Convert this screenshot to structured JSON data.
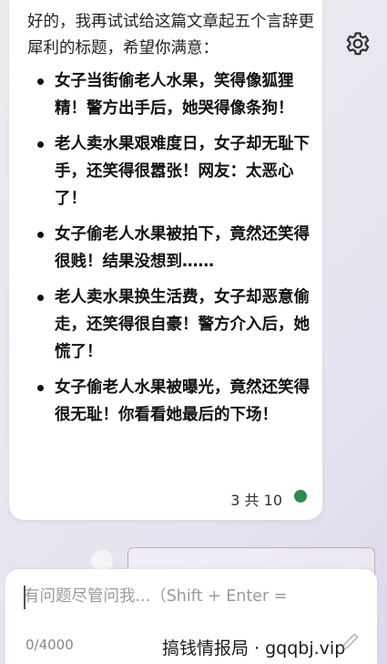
{
  "message": {
    "intro": "好的，我再试试给这篇文章起五个言辞更犀利的标题，希望你满意：",
    "titles": [
      "女子当街偷老人水果，笑得像狐狸精！警方出手后，她哭得像条狗！",
      "老人卖水果艰难度日，女子却无耻下手，还笑得很嚣张！网友：太恶心了！",
      "女子偷老人水果被拍下，竟然还笑得很贱！结果没想到……",
      "老人卖水果换生活费，女子却恶意偷走，还笑得很自豪！警方介入后，她慌了！",
      "女子偷老人水果被曝光，竟然还笑得很无耻！你看看她最后的下场！"
    ],
    "count_label": "3 共 10",
    "status_color": "#2f8a4b"
  },
  "toolbar": {
    "settings_icon": "gear-icon"
  },
  "composer": {
    "placeholder": "有问题尽管问我...（Shift + Enter =",
    "char_count": "0/4000"
  },
  "watermark": "搞钱情报局 · gqqbj.vip"
}
